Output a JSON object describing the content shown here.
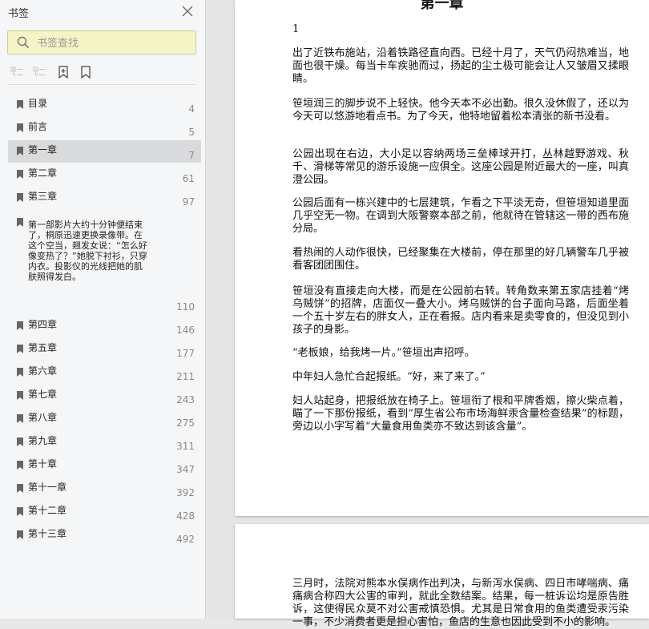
{
  "sidebar": {
    "title": "书签",
    "search_placeholder": "书签查找",
    "bookmarks": [
      {
        "label": "目录",
        "page": "4"
      },
      {
        "label": "前言",
        "page": "5"
      },
      {
        "label": "第一章",
        "page": "7"
      },
      {
        "label": "第二章",
        "page": "61"
      },
      {
        "label": "第三章",
        "page": "97"
      },
      {
        "label": "第一部影片大约十分钟便结束了，桐原迅速更换录像带。在这个空当，翘发女说：“怎么好像变热了？”她脱下衬衫，只穿内衣。投影仪的光线把她的肌肤照得发白。",
        "page": "110"
      },
      {
        "label": "第四章",
        "page": "146"
      },
      {
        "label": "第五章",
        "page": "177"
      },
      {
        "label": "第六章",
        "page": "211"
      },
      {
        "label": "第七章",
        "page": "243"
      },
      {
        "label": "第八章",
        "page": "275"
      },
      {
        "label": "第九章",
        "page": "311"
      },
      {
        "label": "第十章",
        "page": "347"
      },
      {
        "label": "第十一章",
        "page": "392"
      },
      {
        "label": "第十二章",
        "page": "428"
      },
      {
        "label": "第十三章",
        "page": "492"
      }
    ],
    "active_index": 2
  },
  "document": {
    "chapter_title": "第一章",
    "page_number": "1",
    "paragraphs": [
      "出了近铁布施站，沿着铁路径直向西。已经十月了，天气仍闷热难当，地面也很干燥。每当卡车疾驰而过，扬起的尘土极可能会让人又皱眉又揉眼睛。",
      "笹垣润三的脚步说不上轻快。他今天本不必出勤。很久没休假了，还以为今天可以悠游地看点书。为了今天，他特地留着松本清张的新书没看。",
      "公园出现在右边，大小足以容纳两场三垒棒球开打，丛林越野游戏、秋千、滑梯等常见的游乐设施一应俱全。这座公园是附近最大的一座，叫真澄公园。",
      "公园后面有一栋兴建中的七层建筑，乍看之下平淡无奇，但笹垣知道里面几乎空无一物。在调到大阪警察本部之前，他就待在管辖这一带的西布施分局。",
      "看热闹的人动作很快，已经聚集在大楼前，停在那里的好几辆警车几乎被看客团团围住。",
      "笹垣没有直接走向大楼，而是在公园前右转。转角数来第五家店挂着“烤乌贼饼”的招牌，店面仅一叠大小。烤乌贼饼的台子面向马路，后面坐着一个五十岁左右的胖女人，正在看报。店内看来是卖零食的，但没见到小孩子的身影。",
      "“老板娘，给我烤一片。”笹垣出声招呼。",
      "中年妇人急忙合起报纸。“好，来了来了。”",
      "妇人站起身，把报纸放在椅子上。笹垣衔了根和平牌香烟，擦火柴点着，瞄了一下那份报纸，看到“厚生省公布市场海鲜汞含量检查结果”的标题，旁边以小字写着“大量食用鱼类亦不致达到该含量”。"
    ],
    "next_page_paragraph": "三月时，法院对熊本水俣病作出判决，与新泻水俣病、四日市哮喘病、痛痛病合称四大公害的审判，就此全数结案。结果，每一桩诉讼均是原告胜诉，这使得民众莫不对公害戒慎恐惧。尤其是日常食用的鱼类遭受汞污染一事，不少消费者更是担心害怕，鱼店的生意也因此受到不小的影响。"
  },
  "colors": {
    "sidebar_bg": "#f5f6f7",
    "search_bg": "#f4f4c6",
    "active_item_bg": "#d9dadc",
    "doc_bg": "#e6e6e6",
    "page_bg": "#ffffff"
  }
}
